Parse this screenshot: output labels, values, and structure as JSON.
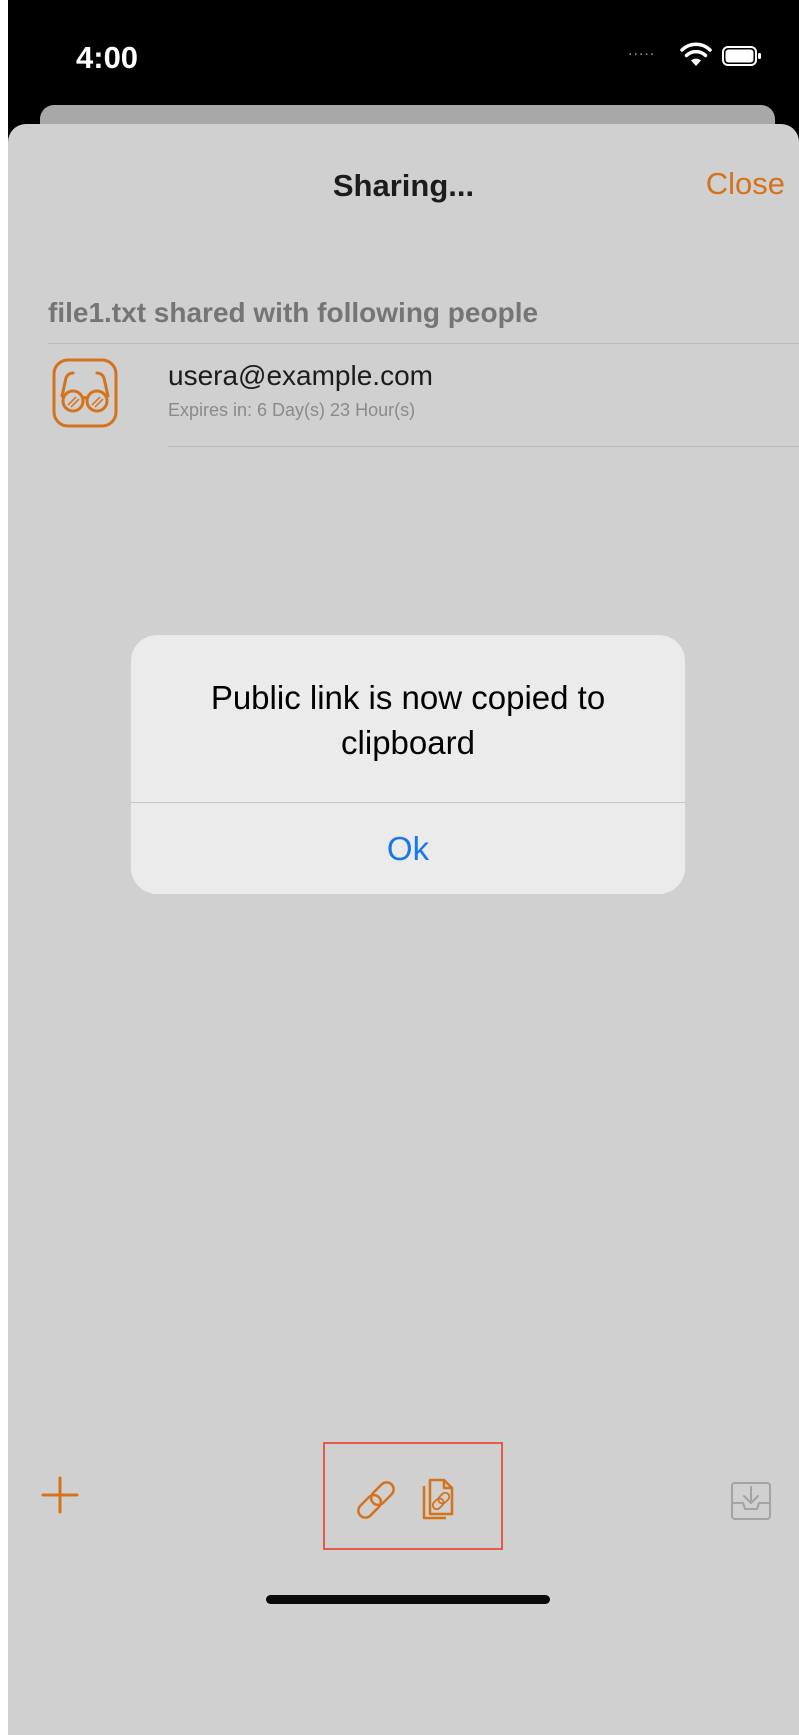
{
  "status_bar": {
    "time": "4:00",
    "signal_text": "....."
  },
  "nav": {
    "title": "Sharing...",
    "close_label": "Close"
  },
  "share_section": {
    "header": "file1.txt shared with following people",
    "shares": [
      {
        "email": "usera@example.com",
        "expiry": "Expires in: 6 Day(s) 23 Hour(s)",
        "icon": "glasses-icon"
      }
    ]
  },
  "alert": {
    "message": "Public link is now copied to clipboard",
    "ok_label": "Ok"
  },
  "toolbar": {
    "items": [
      "plus-icon",
      "link-icon",
      "copy-link-icon",
      "import-icon"
    ]
  },
  "colors": {
    "accent": "#d4731b",
    "alert_button": "#1976f0",
    "sheet_background": "#d0d0d0",
    "highlight_border": "#e25b4b"
  }
}
